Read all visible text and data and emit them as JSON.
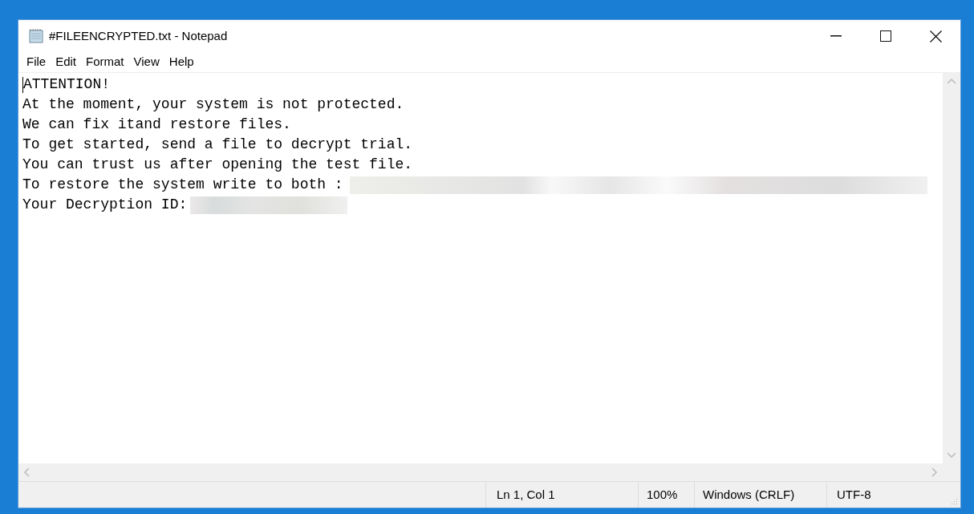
{
  "window": {
    "title": "#FILEENCRYPTED.txt - Notepad"
  },
  "menu": [
    "File",
    "Edit",
    "Format",
    "View",
    "Help"
  ],
  "document": {
    "lines": [
      {
        "text": "ATTENTION!",
        "redacted": false
      },
      {
        "text": "At the moment, your system is not protected.",
        "redacted": false
      },
      {
        "text": "We can fix itand restore files.",
        "redacted": false
      },
      {
        "text": "To get started, send a file to decrypt trial.",
        "redacted": false
      },
      {
        "text": "You can trust us after opening the test file.",
        "redacted": false
      },
      {
        "text": "To restore the system write to both :",
        "redacted": true
      },
      {
        "text": "Your Decryption ID:",
        "redacted": true
      }
    ]
  },
  "status_bar": {
    "position": "Ln 1, Col 1",
    "zoom": "100%",
    "line_ending": "Windows (CRLF)",
    "encoding": "UTF-8"
  }
}
